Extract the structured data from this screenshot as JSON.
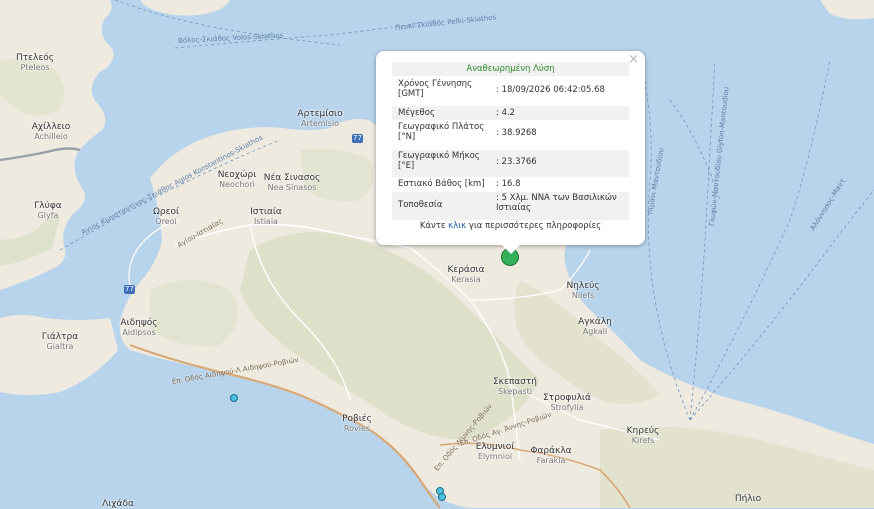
{
  "popup": {
    "title": "Αναθεωρημένη Λύση",
    "close_symbol": "×",
    "rows": [
      {
        "key": "Χρόνος Γέννησης [GMT]",
        "value": ": 18/09/2026 06:42:05.68"
      },
      {
        "key": "Μέγεθος",
        "value": ": 4.2"
      },
      {
        "key": "Γεωγραφικό Πλάτος [°N]",
        "value": ": 38.9268"
      },
      {
        "key": "Γεωγραφικό Μήκος [°E]",
        "value": ": 23.3766"
      },
      {
        "key": "Εστιακό Βάθος [km]",
        "value": ": 16.8"
      },
      {
        "key": "Τοποθεσία",
        "value": ": 5 Χλμ. ΝΝΑ των Βασιλικών Ιστιαίας"
      }
    ],
    "more_prefix": "Κάντε ",
    "more_link": "κλικ",
    "more_suffix": " για περισσότερες πληροφορίες"
  },
  "places": [
    {
      "gr": "Πτελεός",
      "en": "Pteleos"
    },
    {
      "gr": "Αχίλλειο",
      "en": "Achilleio"
    },
    {
      "gr": "Γλύφα",
      "en": "Glyfa"
    },
    {
      "gr": "Αρτεμίσιο",
      "en": "Artemisio"
    },
    {
      "gr": "Νεοχώρι",
      "en": "Neochori"
    },
    {
      "gr": "Νέα Σινασος",
      "en": "Nea Sinasos"
    },
    {
      "gr": "Ωρεοί",
      "en": "Oreoi"
    },
    {
      "gr": "Ιστιαία",
      "en": "Istiaia"
    },
    {
      "gr": "Κεράσια",
      "en": "Kerasia"
    },
    {
      "gr": "Νηλεύς",
      "en": "Nilefs"
    },
    {
      "gr": "Αγκάλη",
      "en": "Agkali"
    },
    {
      "gr": "Αιδηψός",
      "en": "Aidipsos"
    },
    {
      "gr": "Γιάλτρα",
      "en": "Gialtra"
    },
    {
      "gr": "Σκεπαστή",
      "en": "Skepasti"
    },
    {
      "gr": "Στροφυλιά",
      "en": "Strofylia"
    },
    {
      "gr": "Ροβιές",
      "en": "Rovies"
    },
    {
      "gr": "Ελυμνιοί",
      "en": "Elymnioi"
    },
    {
      "gr": "Φαράκλα",
      "en": "Farakla"
    },
    {
      "gr": "Κηρεύς",
      "en": "Kirefs"
    },
    {
      "gr": "Πήλιο",
      "en": ""
    },
    {
      "gr": "Λιχάδα",
      "en": ""
    }
  ],
  "road_labels": [
    {
      "text": "Αγίου-Ιστιαίας"
    },
    {
      "text": "Επ. Οδός Λίμνης-Ροβιών"
    },
    {
      "text": "Επ. Οδός Αγ. Άννης-Ροβιών"
    },
    {
      "text": "Επ. Οδός Αιδηψού-Λ Αιδηψού-Ροβιών"
    }
  ],
  "ferry_labels": [
    {
      "text": "Βόλος-Σκιάθος Volos-Skiathos"
    },
    {
      "text": "Πευκί-Σκιάθος Pefki-Skiathos"
    },
    {
      "text": "Αγιος Κωνσταντίνος-Σκιάθος Agios Konstantinos-Skiathos"
    },
    {
      "text": "Γλυφών-Μαντουδίου Glyfon-Mantoudiou"
    },
    {
      "text": "Αλόννησος-Μαντ"
    },
    {
      "text": "Λιμάνι Μαντουδίου"
    }
  ],
  "road_shields": [
    {
      "text": "77"
    },
    {
      "text": "77"
    }
  ],
  "colors": {
    "sea": "#b8d4ec",
    "land": "#efeae0",
    "hills": "#d8dcc2",
    "road": "#ffffff",
    "highway": "#d8a977",
    "quake_marker": "#35b05a",
    "small_event": "#49c1dc",
    "title_green": "#2e8b2e",
    "link_blue": "#1a5fb4"
  }
}
